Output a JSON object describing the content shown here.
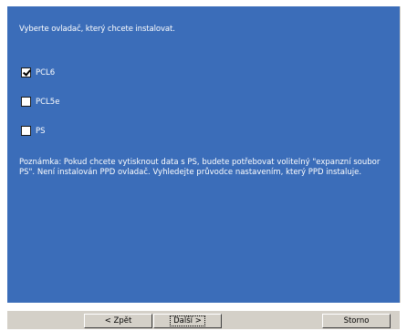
{
  "prompt": "Vyberte ovladač, který chcete instalovat.",
  "options": [
    {
      "label": "PCL6",
      "checked": true
    },
    {
      "label": "PCL5e",
      "checked": false
    },
    {
      "label": "PS",
      "checked": false
    }
  ],
  "note": "Poznámka: Pokud chcete vytisknout data s PS, budete potřebovat volitelný \"expanzní soubor PS\". Není instalován PPD ovladač. Vyhledejte průvodce nastavením, který PPD instaluje.",
  "buttons": {
    "back": "< Zpět",
    "next": "Další >",
    "cancel": "Storno"
  },
  "colors": {
    "panel": "#3b6db9",
    "button_face": "#d4d0c8"
  }
}
